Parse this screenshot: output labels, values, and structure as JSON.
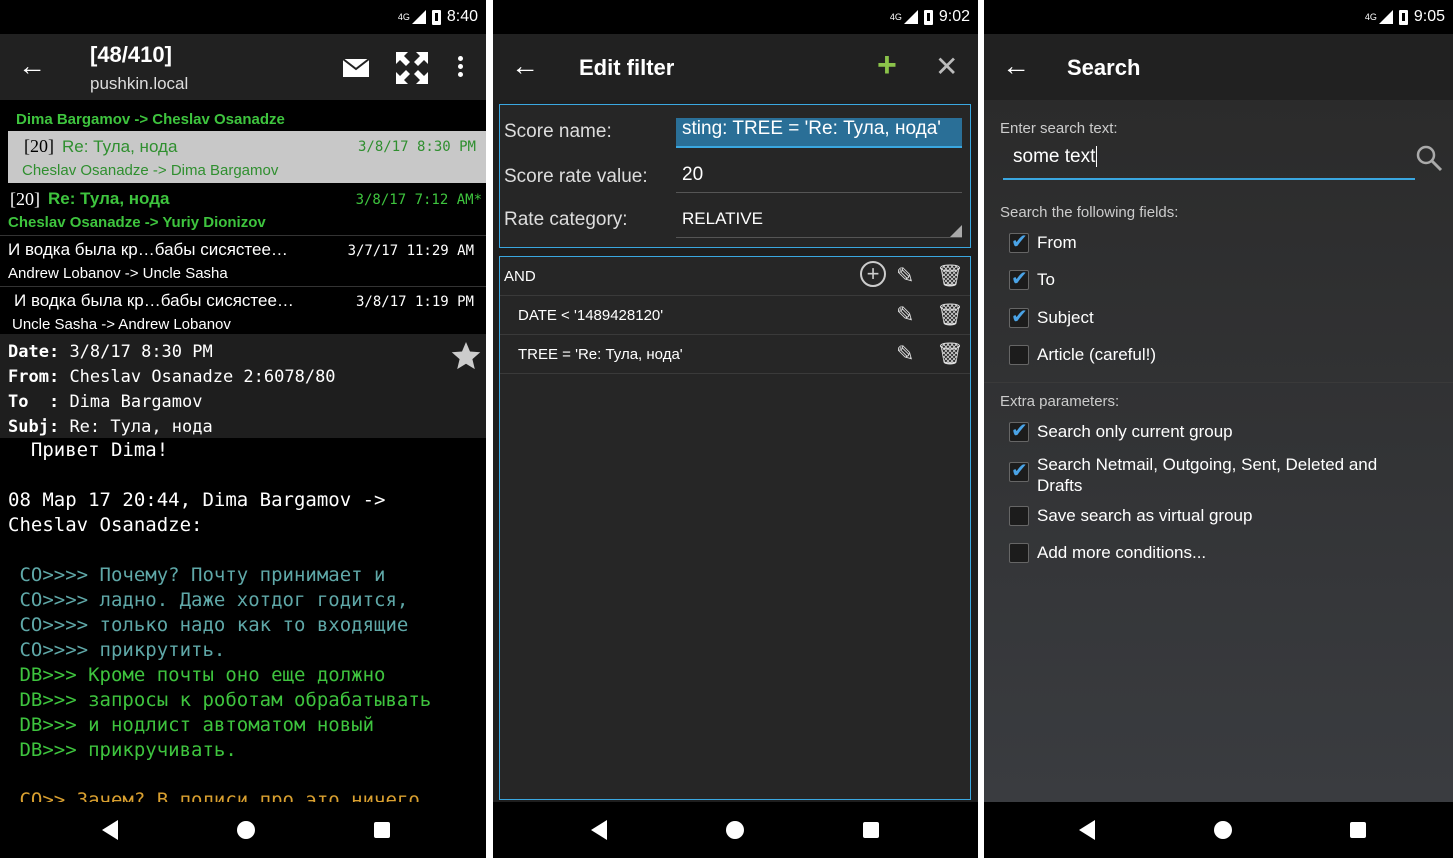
{
  "status": {
    "s1_time": "8:40",
    "s2_time": "9:02",
    "s3_time": "9:05",
    "network": "4G"
  },
  "reader": {
    "title": "[48/410]",
    "subtitle": "pushkin.local",
    "messages": [
      {
        "num": "",
        "subject": "",
        "date": "",
        "from_to": "Dima Bargamov -> Cheslav Osanadze",
        "style": "partial"
      },
      {
        "num": "[20]",
        "subject": "Re: Тула, нода",
        "date": "3/8/17 8:30 PM",
        "from_to": "Cheslav Osanadze -> Dima Bargamov",
        "style": "selected"
      },
      {
        "num": "[20]",
        "subject": "Re: Тула, нода",
        "date": "3/8/17 7:12 AM*",
        "from_to": "Cheslav Osanadze -> Yuriy Dionizov",
        "style": "new"
      },
      {
        "num": "",
        "subject": "И водка была кр…бабы сисястее…",
        "date": "3/7/17 11:29 AM",
        "from_to": "Andrew Lobanov -> Uncle Sasha",
        "style": "normal"
      },
      {
        "num": "",
        "subject": "И водка была кр…бабы сисястее…",
        "date": "3/8/17 1:19 PM",
        "from_to": "Uncle Sasha -> Andrew Lobanov",
        "style": "indent"
      }
    ],
    "header": {
      "date_label": "Date:",
      "date_value": "3/8/17 8:30 PM",
      "from_label": "From:",
      "from_value": "Cheslav Osanadze 2:6078/80",
      "to_label": "To  :",
      "to_value": "Dima Bargamov",
      "subj_label": "Subj:",
      "subj_value": "Re: Тула, нода"
    },
    "body": [
      {
        "text": "  Привет Dima!",
        "color": "#ffffff"
      },
      {
        "text": "",
        "color": "#ffffff"
      },
      {
        "text": "08 Мар 17 20:44, Dima Bargamov ->",
        "color": "#ffffff"
      },
      {
        "text": "Cheslav Osanadze:",
        "color": "#ffffff"
      },
      {
        "text": "",
        "color": "#ffffff"
      },
      {
        "text": " CO>>>> Почему? Почту принимает и",
        "color": "#5fa8a8"
      },
      {
        "text": " CO>>>> ладно. Даже хотдог годится,",
        "color": "#5fa8a8"
      },
      {
        "text": " CO>>>> только надо как то входящие",
        "color": "#5fa8a8"
      },
      {
        "text": " CO>>>> прикрутить.",
        "color": "#5fa8a8"
      },
      {
        "text": " DB>>> Кроме почты оно еще должно",
        "color": "#3ec43e"
      },
      {
        "text": " DB>>> запросы к роботам обрабатывать",
        "color": "#3ec43e"
      },
      {
        "text": " DB>>> и нодлист автоматом новый",
        "color": "#3ec43e"
      },
      {
        "text": " DB>>> прикручивать.",
        "color": "#3ec43e"
      },
      {
        "text": "",
        "color": "#ffffff"
      },
      {
        "text": " CO>> Зачем? В полиси про это ничего",
        "color": "#d9a030"
      }
    ]
  },
  "filter": {
    "title": "Edit filter",
    "score_name_label": "Score name:",
    "score_name_value": "sting: TREE = 'Re: Тула, нода'",
    "score_rate_label": "Score rate value:",
    "score_rate_value": "20",
    "rate_category_label": "Rate category:",
    "rate_category_value": "RELATIVE",
    "conditions": [
      {
        "text": "AND"
      },
      {
        "text": "DATE < '1489428120'"
      },
      {
        "text": "TREE = 'Re: Тула, нода'"
      }
    ]
  },
  "search": {
    "title": "Search",
    "enter_label": "Enter search text:",
    "search_value": "some text",
    "fields_label": "Search the following fields:",
    "fields": [
      {
        "label": "From",
        "checked": true
      },
      {
        "label": "To",
        "checked": true
      },
      {
        "label": "Subject",
        "checked": true
      },
      {
        "label": "Article (careful!)",
        "checked": false
      }
    ],
    "extra_label": "Extra parameters:",
    "extra": [
      {
        "label": "Search only current group",
        "checked": true
      },
      {
        "label": "Search Netmail, Outgoing, Sent, Deleted and Drafts",
        "checked": true
      },
      {
        "label": "Save search as virtual group",
        "checked": false
      },
      {
        "label": "Add more conditions...",
        "checked": false
      }
    ]
  },
  "colors": {
    "accent": "#3aa7e0",
    "green": "#3ec43e",
    "add": "#8bc34a"
  }
}
